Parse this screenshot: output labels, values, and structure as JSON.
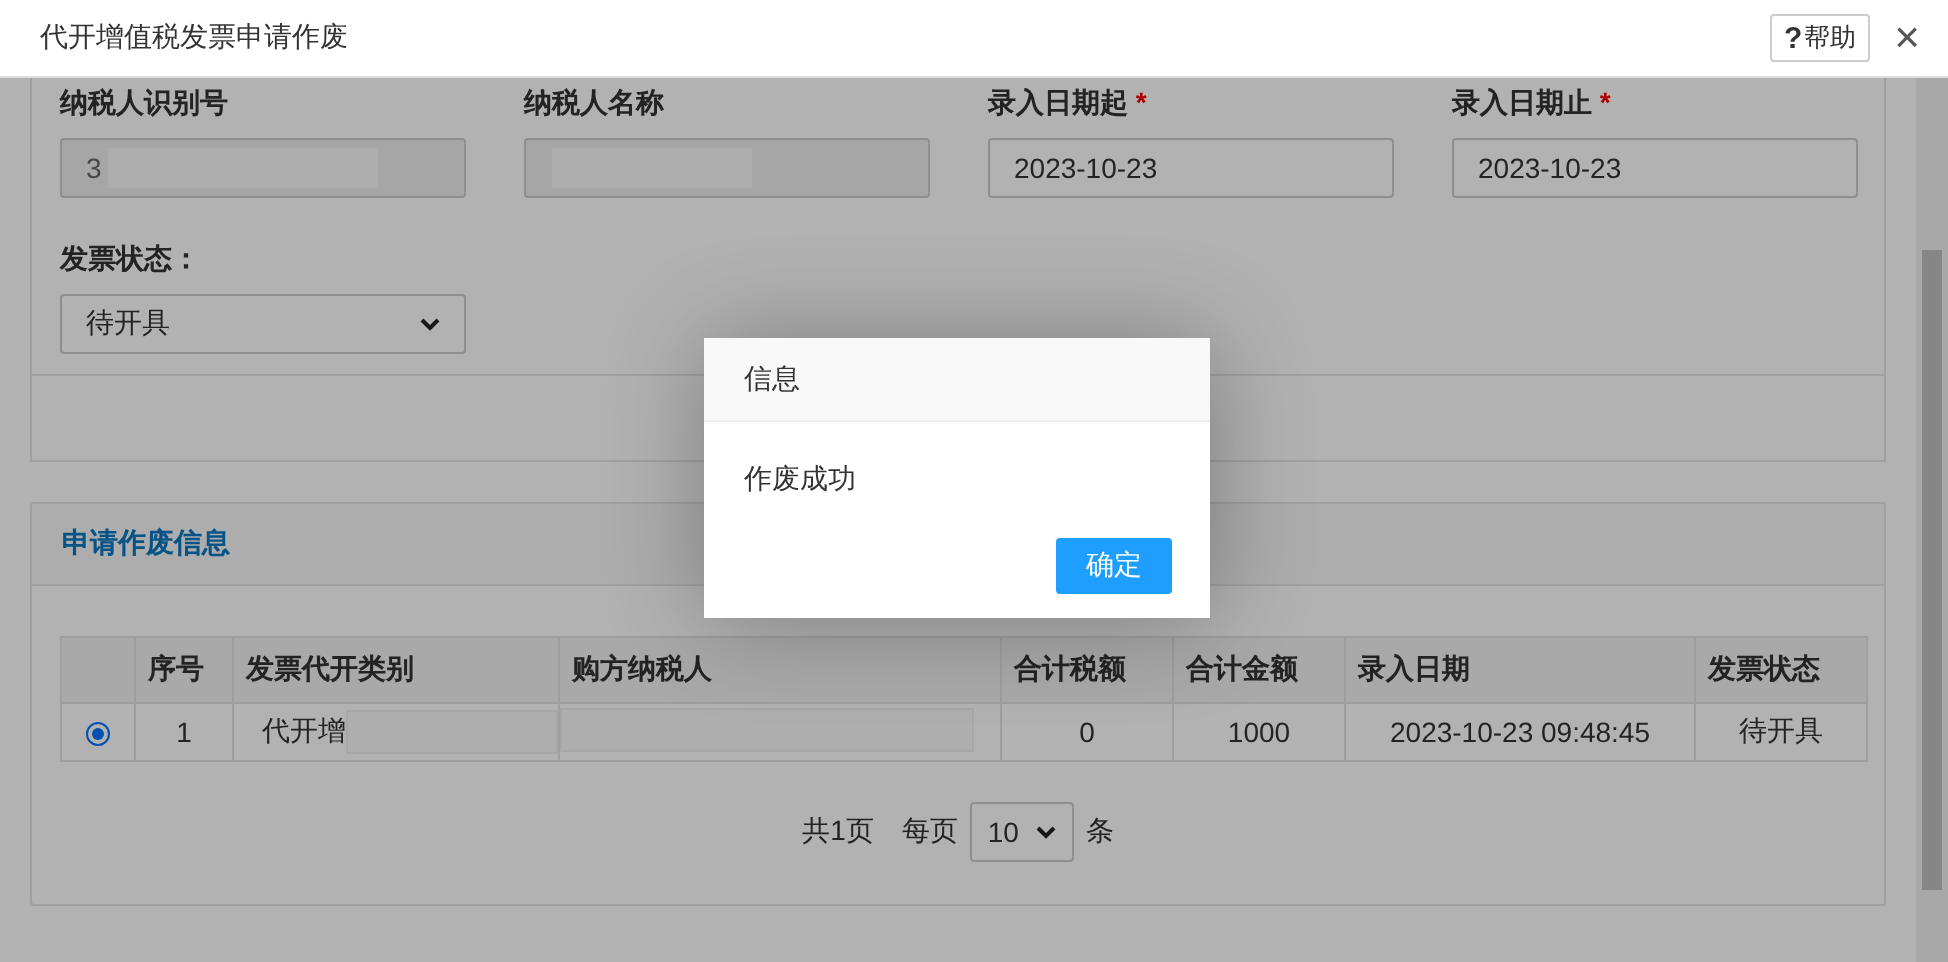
{
  "window": {
    "title": "代开增值税发票申请作废",
    "help": "帮助",
    "help_mark": "?",
    "close": "×"
  },
  "filters": [
    {
      "kind": "text",
      "label": "纳税人识别号",
      "required": false,
      "value": "3",
      "redacted": true,
      "disabled": true
    },
    {
      "kind": "text",
      "label": "纳税人名称",
      "required": false,
      "redacted": true,
      "disabled": true
    },
    {
      "kind": "text",
      "label": "录入日期起",
      "required": true,
      "value": "2023-10-23",
      "disabled": false
    },
    {
      "kind": "text",
      "label": "录入日期止",
      "required": true,
      "value": "2023-10-23",
      "disabled": false
    },
    {
      "kind": "select",
      "label": "发票状态：",
      "required": false,
      "value": "待开具",
      "disabled": false
    }
  ],
  "required_mark": "*",
  "section": {
    "title": "申请作废信息"
  },
  "table": {
    "columns": [
      "序号",
      "发票代开类别",
      "购方纳税人",
      "合计税额",
      "合计金额",
      "录入日期",
      "发票状态"
    ],
    "rows": [
      {
        "selected": true,
        "cells": [
          "1",
          "代开增",
          "",
          "0",
          "1000",
          "2023-10-23 09:48:45",
          "待开具"
        ]
      }
    ]
  },
  "pagination": {
    "total": "共1页",
    "per_page_label": "每页",
    "per_page": "10",
    "unit": "条"
  },
  "dialog": {
    "title": "信息",
    "message": "作废成功",
    "button": "确定"
  }
}
